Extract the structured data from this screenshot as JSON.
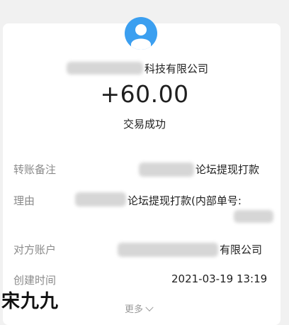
{
  "transaction": {
    "merchant_suffix": "科技有限公司",
    "amount": "+60.00",
    "status": "交易成功"
  },
  "details": {
    "remark_label": "转账备注",
    "remark_value_suffix": "论坛提现打款",
    "reason_label": "理由",
    "reason_value_suffix": "论坛提现打款(内部单号:",
    "counterparty_label": "对方账户",
    "counterparty_value_suffix": "有限公司",
    "created_label": "创建时间",
    "created_value": "2021-03-19 13:19"
  },
  "more_label": "更多",
  "watermark": "宋九九",
  "colors": {
    "avatar_bg": "#3b9ff0",
    "label_gray": "#8a8a8a",
    "page_bg": "#f1f1f1"
  }
}
